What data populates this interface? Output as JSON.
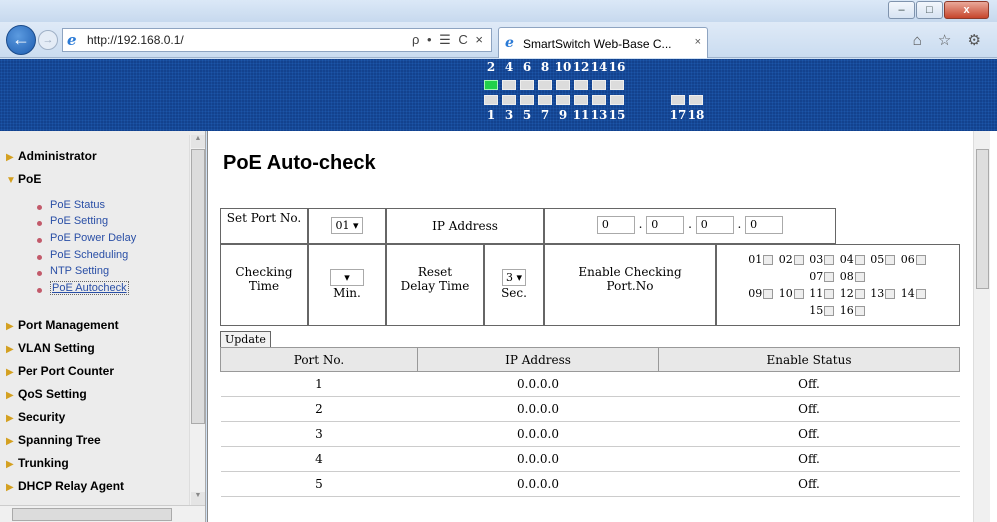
{
  "browser": {
    "url": "http://192.168.0.1/",
    "addr_tools": "ρ • ☰ C ×",
    "tab_title": "SmartSwitch Web-Base C...",
    "tab_close": "×",
    "window_buttons": {
      "min": "–",
      "max": "□",
      "close": "x"
    },
    "icons": "⌂ ☆ ⚙"
  },
  "ports": {
    "top_labels": [
      "2",
      "4",
      "6",
      "8",
      "10",
      "12",
      "14",
      "16"
    ],
    "bottom_labels": [
      "1",
      "3",
      "5",
      "7",
      "9",
      "11",
      "13",
      "15",
      "17",
      "18"
    ],
    "active_port": "2"
  },
  "sidebar": {
    "items": [
      {
        "label": "Administrator"
      },
      {
        "label": "PoE"
      },
      {
        "label": "Port Management"
      },
      {
        "label": "VLAN Setting"
      },
      {
        "label": "Per Port Counter"
      },
      {
        "label": "QoS Setting"
      },
      {
        "label": "Security"
      },
      {
        "label": "Spanning Tree"
      },
      {
        "label": "Trunking"
      },
      {
        "label": "DHCP Relay Agent"
      }
    ],
    "poe_sub": [
      {
        "label": "PoE Status"
      },
      {
        "label": "PoE Setting"
      },
      {
        "label": "PoE Power Delay"
      },
      {
        "label": "PoE Scheduling"
      },
      {
        "label": "NTP Setting"
      },
      {
        "label": "PoE Autocheck"
      }
    ]
  },
  "page": {
    "title": "PoE Auto-check",
    "set_port_label": "Set Port No.",
    "set_port_value": "01",
    "ip_label": "IP Address",
    "ip_octets": [
      "0",
      "0",
      "0",
      "0"
    ],
    "checking_time_label": "Checking Time",
    "checking_time_value": "",
    "checking_time_unit": "Min.",
    "reset_delay_label": "Reset Delay Time",
    "reset_delay_value": "3",
    "reset_delay_unit": "Sec.",
    "enable_port_label": "Enable Checking Port.No",
    "port_checkboxes_row1": [
      "01",
      "02",
      "03",
      "04",
      "05",
      "06"
    ],
    "port_checkboxes_row2": [
      "07",
      "08"
    ],
    "port_checkboxes_row3": [
      "09",
      "10",
      "11",
      "12",
      "13",
      "14"
    ],
    "port_checkboxes_row4": [
      "15",
      "16"
    ],
    "update_label": "Update",
    "table_headers": [
      "Port No.",
      "IP Address",
      "Enable Status"
    ],
    "rows": [
      {
        "port": "1",
        "ip": "0.0.0.0",
        "status": "Off."
      },
      {
        "port": "2",
        "ip": "0.0.0.0",
        "status": "Off."
      },
      {
        "port": "3",
        "ip": "0.0.0.0",
        "status": "Off."
      },
      {
        "port": "4",
        "ip": "0.0.0.0",
        "status": "Off."
      },
      {
        "port": "5",
        "ip": "0.0.0.0",
        "status": "Off."
      }
    ]
  }
}
